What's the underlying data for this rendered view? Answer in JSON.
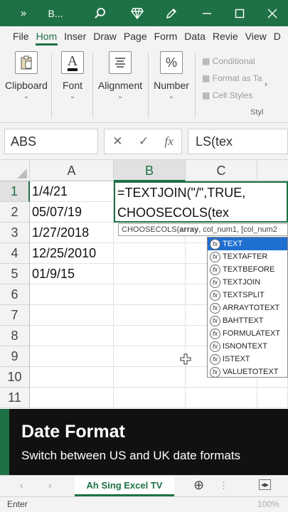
{
  "titlebar": {
    "expand": "»",
    "file_name": "B...",
    "icons": [
      "search-icon",
      "diamond-icon",
      "pen-icon",
      "minimize-icon",
      "maximize-icon",
      "close-icon"
    ]
  },
  "ribbon_tabs": [
    "File",
    "Hom",
    "Inser",
    "Draw",
    "Page",
    "Form",
    "Data",
    "Revie",
    "View",
    "D"
  ],
  "ribbon": {
    "clipboard": "Clipboard",
    "font": "Font",
    "alignment": "Alignment",
    "number": "Number",
    "number_symbol": "%",
    "font_symbol": "A",
    "conditional": "Conditional",
    "format_as": "Format as Ta",
    "cell_styles": "Cell Styles",
    "styles_label": "Styl"
  },
  "formula": {
    "name_box": "ABS",
    "cancel": "✕",
    "enter": "✓",
    "fx": "fx",
    "content": "LS(tex"
  },
  "columns": [
    "A",
    "B",
    "C"
  ],
  "rows": [
    "1",
    "2",
    "3",
    "4",
    "5",
    "6",
    "7",
    "8",
    "9",
    "10",
    "11"
  ],
  "column_a": [
    "1/4/21",
    "05/07/19",
    "1/27/2018",
    "12/25/2010",
    "01/9/15"
  ],
  "edit_cell": {
    "line1": "=TEXTJOIN(\"/\",TRUE,",
    "line2_func": "CHOOSECOLS(",
    "line2_arg": "tex"
  },
  "tooltip": {
    "func": "CHOOSECOLS(",
    "arg1": "array",
    "rest": ", col_num1, [col_num2"
  },
  "autocomplete": [
    "TEXT",
    "TEXTAFTER",
    "TEXTBEFORE",
    "TEXTJOIN",
    "TEXTSPLIT",
    "ARRAYTOTEXT",
    "BAHTTEXT",
    "FORMULATEXT",
    "ISNONTEXT",
    "ISTEXT",
    "VALUETOTEXT"
  ],
  "banner": {
    "title": "Date Format",
    "subtitle": "Switch between US and UK date formats"
  },
  "sheet": {
    "tab_name": "Ah Sing Excel TV",
    "add": "⊕"
  },
  "status": {
    "mode": "Enter",
    "zoom": "100%"
  },
  "colors": {
    "accent": "#1e7145",
    "autocomplete_selected": "#1f6fd1"
  }
}
